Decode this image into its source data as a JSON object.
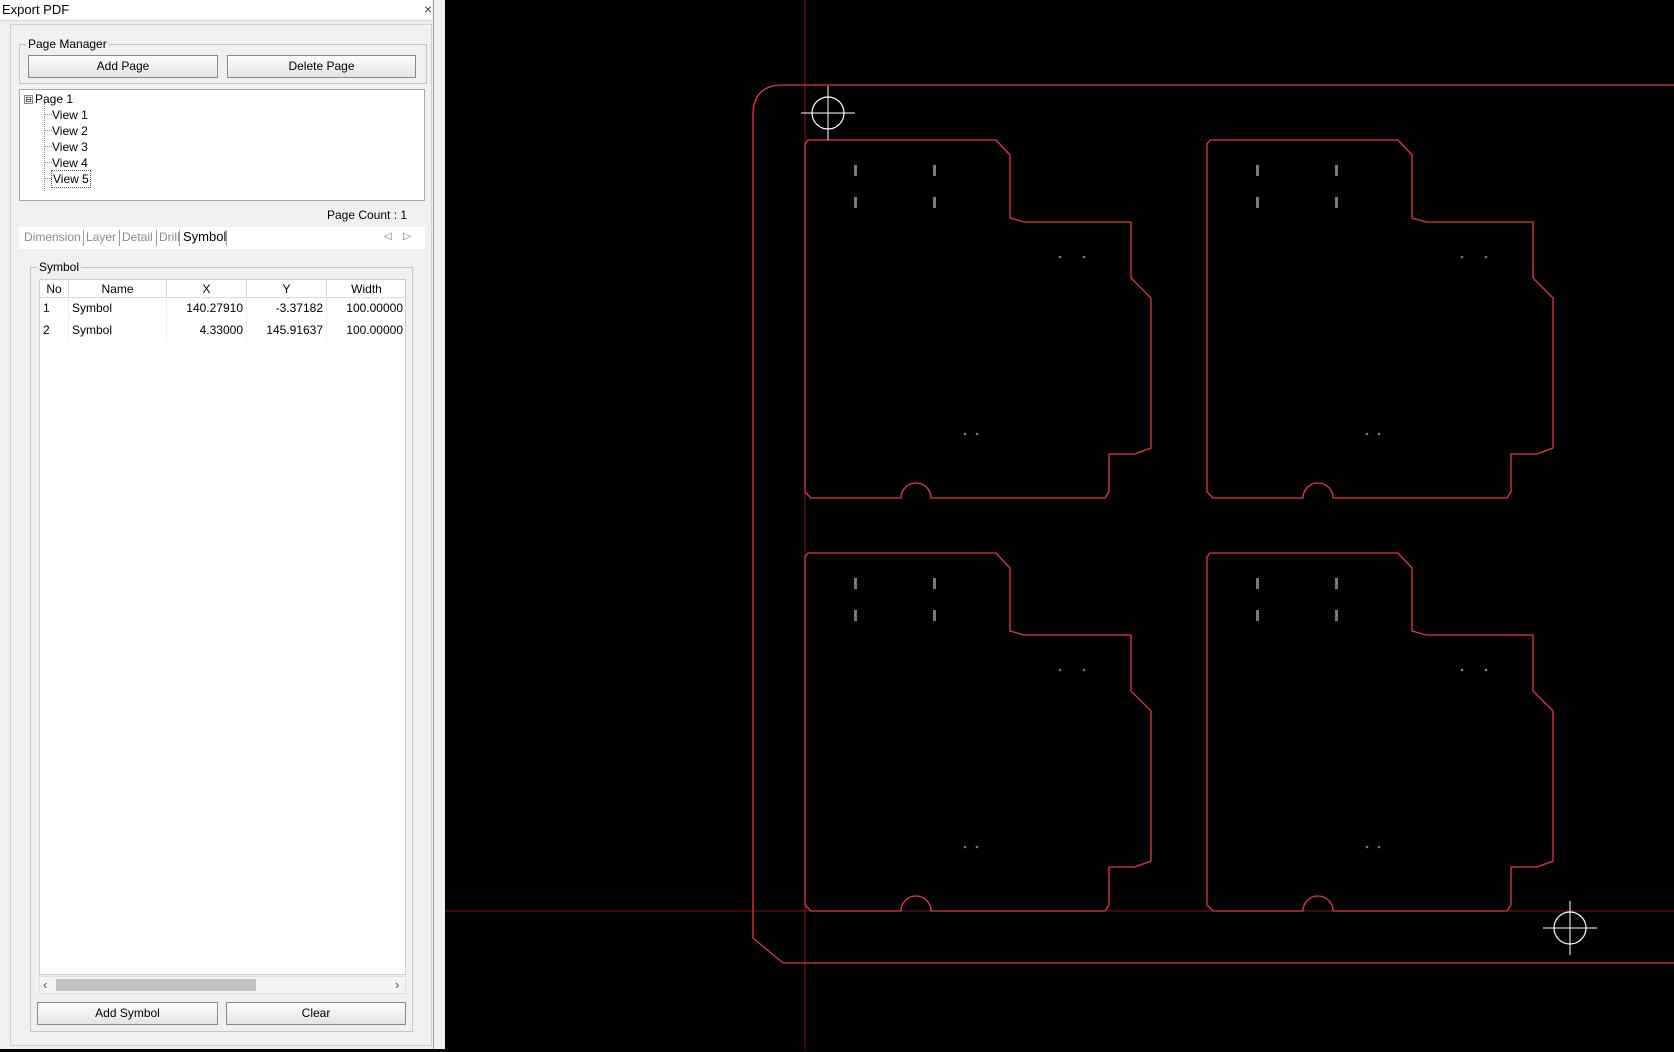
{
  "window": {
    "title": "Export PDF",
    "close_label": "×"
  },
  "page_manager": {
    "legend": "Page Manager",
    "add_page_label": "Add Page",
    "delete_page_label": "Delete Page",
    "tree": {
      "root": "Page 1",
      "expander": "⊟",
      "children": [
        "View 1",
        "View 2",
        "View 3",
        "View 4",
        "View 5"
      ],
      "selected": "View 5"
    },
    "page_count": "Page Count : 1"
  },
  "tabs": {
    "items": [
      "Dimension",
      "Layer",
      "Detail",
      "Drill",
      "Symbol"
    ],
    "active": "Symbol",
    "left_arrow": "◁",
    "right_arrow": "▷"
  },
  "symbol_group": {
    "legend": "Symbol",
    "columns": [
      "No",
      "Name",
      "X",
      "Y",
      "Width"
    ],
    "rows": [
      {
        "no": "1",
        "name": "Symbol",
        "x": "140.27910",
        "y": "-3.37182",
        "width": "100.00000"
      },
      {
        "no": "2",
        "name": "Symbol",
        "x": "4.33000",
        "y": "145.91637",
        "width": "100.00000"
      }
    ],
    "add_symbol_label": "Add Symbol",
    "clear_label": "Clear",
    "scroll_left": "‹",
    "scroll_right": "›"
  },
  "colors": {
    "outline": "#e0393f",
    "crosshair_line": "#8a1010",
    "fiducial": "#ffffff",
    "slot": "#7a7a7a",
    "background": "#000000"
  }
}
